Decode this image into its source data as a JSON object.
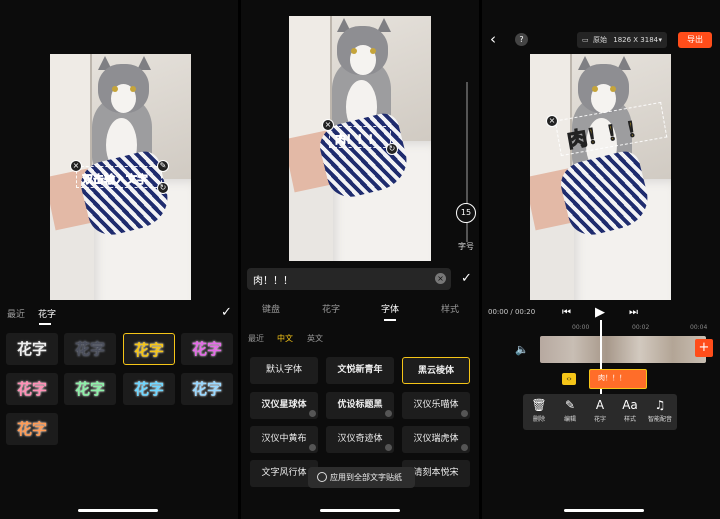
{
  "panel1": {
    "sticker_text": "双击输入文字",
    "tabs": [
      "最近",
      "花字"
    ],
    "active_tab": "花字",
    "confirm_icon": "check-icon",
    "tiles": [
      {
        "label": "花字",
        "color": "#f0f0f0",
        "stroke": "#7a7a7a"
      },
      {
        "label": "花字",
        "color": "#4b4f5c",
        "stroke": "#9aa0b0"
      },
      {
        "label": "花字",
        "color": "#f5c518",
        "stroke": "#ffffff",
        "selected": true
      },
      {
        "label": "花字",
        "color": "#e46be7",
        "stroke": "#ffffff"
      },
      {
        "label": "花字",
        "color": "#ff8fb5",
        "stroke": "#ffffff"
      },
      {
        "label": "花字",
        "color": "#8df0a8",
        "stroke": "#ffffff"
      },
      {
        "label": "花字",
        "color": "#6fd6ff",
        "stroke": "#ffffff"
      },
      {
        "label": "花字",
        "color": "#9ad8ff",
        "stroke": "#ffffff"
      },
      {
        "label": "花字",
        "color": "#ff9b55",
        "stroke": "#ffffff"
      }
    ]
  },
  "panel2": {
    "sticker_text": "肉！！！",
    "font_size_value": "15",
    "font_size_label": "字号",
    "input_value": "肉！！！",
    "tabs": [
      "键盘",
      "花字",
      "字体",
      "样式"
    ],
    "active_tab": "字体",
    "subtabs": [
      "最近",
      "中文",
      "英文"
    ],
    "active_subtab": "中文",
    "fonts": [
      {
        "label": "默认字体"
      },
      {
        "label": "文悦新青年"
      },
      {
        "label": "黑云棱体",
        "selected": true
      },
      {
        "label": "汉仪星球体"
      },
      {
        "label": "优设标题黑"
      },
      {
        "label": "汉仪乐喵体"
      },
      {
        "label": "汉仪中黄布"
      },
      {
        "label": "汉仪奇迹体"
      },
      {
        "label": "汉仪瑞虎体"
      },
      {
        "label": "文字风行体"
      },
      {
        "label": ""
      },
      {
        "label": "清刻本悦宋"
      }
    ],
    "apply_all_label": "应用到全部文字贴纸"
  },
  "panel3": {
    "sticker_text": "肉！！！",
    "resolution_label": "原始",
    "resolution_value": "1826 X 3184",
    "export_label": "导出",
    "timecode": "00:00 / 00:20",
    "ruler_marks": [
      "00:00",
      "00:02",
      "00:04"
    ],
    "text_clip_label": "肉！！！",
    "tools": [
      {
        "label": "删除",
        "glyph": "🗑"
      },
      {
        "label": "编辑",
        "glyph": "✎"
      },
      {
        "label": "花字",
        "glyph": "A"
      },
      {
        "label": "样式",
        "glyph": "Aa"
      },
      {
        "label": "智能配音",
        "glyph": "♫"
      }
    ]
  }
}
